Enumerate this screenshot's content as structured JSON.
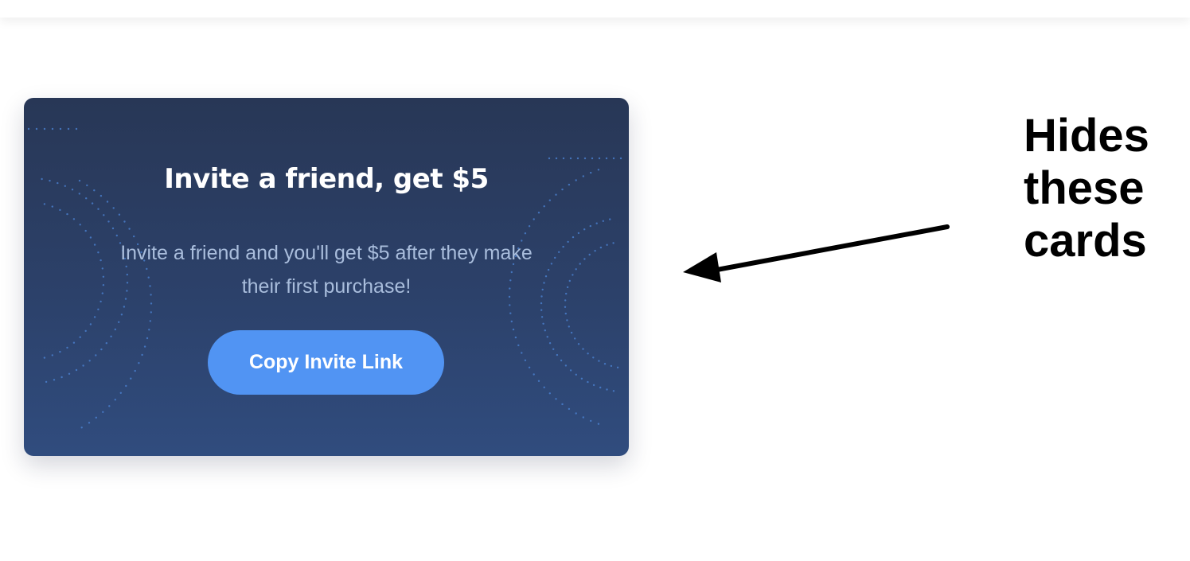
{
  "card": {
    "title": "Invite a friend, get $5",
    "description": "Invite a friend and you'll get $5 after they make their first purchase!",
    "button_label": "Copy Invite Link"
  },
  "annotation": {
    "text": "Hides\nthese\ncards"
  },
  "colors": {
    "card_background": "#2c416a",
    "button": "#5194f3",
    "description_text": "#a9bddc",
    "dots": "#4d86d8"
  }
}
